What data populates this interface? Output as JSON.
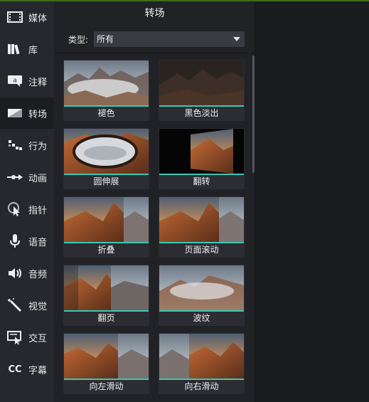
{
  "sidebar": {
    "items": [
      {
        "label": "媒体",
        "icon": "film-strip-icon"
      },
      {
        "label": "库",
        "icon": "library-books-icon"
      },
      {
        "label": "注释",
        "icon": "annotation-icon"
      },
      {
        "label": "转场",
        "icon": "transition-icon"
      },
      {
        "label": "行为",
        "icon": "behavior-icon"
      },
      {
        "label": "动画",
        "icon": "animation-arrow-icon"
      },
      {
        "label": "指针",
        "icon": "cursor-pointer-icon"
      },
      {
        "label": "语音",
        "icon": "microphone-icon"
      },
      {
        "label": "音频",
        "icon": "speaker-icon"
      },
      {
        "label": "视觉",
        "icon": "magic-wand-icon"
      },
      {
        "label": "交互",
        "icon": "interactive-icon"
      },
      {
        "label": "字幕",
        "icon": "closed-caption-icon"
      }
    ],
    "active_index": 3,
    "cc_glyph": "CC"
  },
  "panel": {
    "title": "转场",
    "type_label": "类型:",
    "type_value": "所有"
  },
  "transitions": [
    {
      "name": "褪色"
    },
    {
      "name": "黑色淡出"
    },
    {
      "name": "圆伸展"
    },
    {
      "name": "翻转"
    },
    {
      "name": "折叠"
    },
    {
      "name": "页面滚动"
    },
    {
      "name": "翻页"
    },
    {
      "name": "波纹"
    },
    {
      "name": "向左滑动"
    },
    {
      "name": "向右滑动"
    }
  ],
  "colors": {
    "accent": "#3cc7b2",
    "sidebar_bg": "#27282d",
    "panel_bg": "#212226",
    "active_item_bg": "#1c1d21",
    "top_line": "#3c6e1d"
  }
}
